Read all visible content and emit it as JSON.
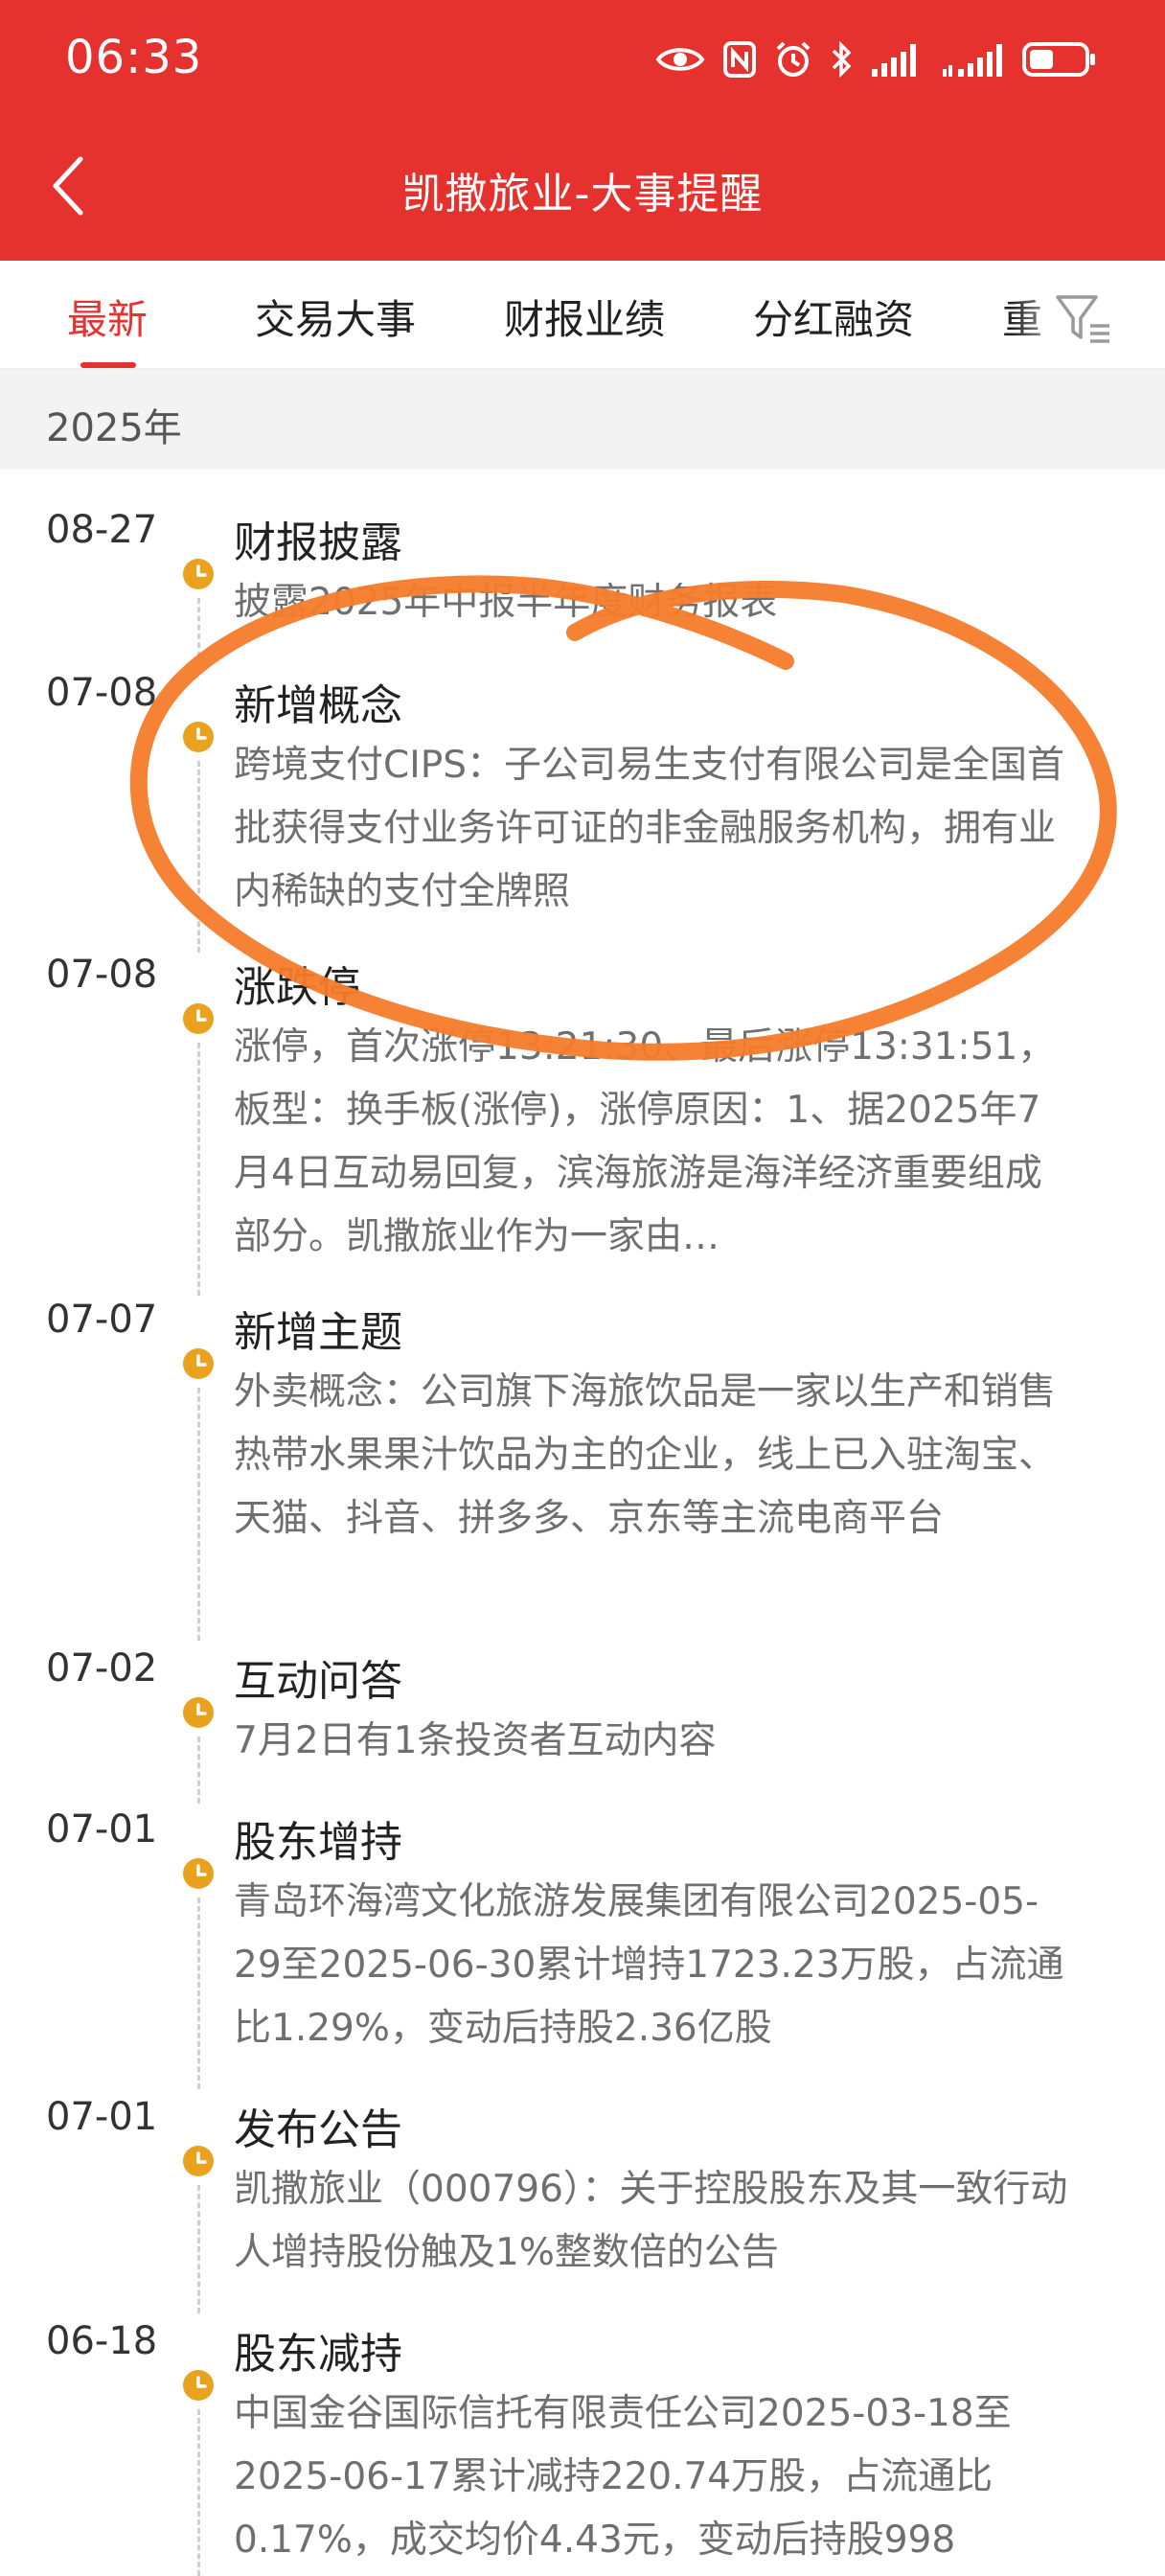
{
  "status_bar": {
    "time": "06:33",
    "battery_level": 0.45
  },
  "header": {
    "title": "凯撒旅业-大事提醒",
    "back_icon": "chevron-left-icon",
    "background_color": "#e5322f"
  },
  "tabs": [
    {
      "label": "最新",
      "active": true
    },
    {
      "label": "交易大事",
      "active": false
    },
    {
      "label": "财报业绩",
      "active": false
    },
    {
      "label": "分红融资",
      "active": false
    },
    {
      "label": "重",
      "active": false
    }
  ],
  "filter_icon": "filter-icon",
  "accent_color": "#e5322f",
  "timeline_dot_color": "#e8a21e",
  "highlight_stroke_color": "#f47b2a",
  "year": "2025年",
  "events": [
    {
      "date": "08-27",
      "title": "财报披露",
      "desc": "披露2025年中报半年度财务报表"
    },
    {
      "date": "07-08",
      "title": "新增概念",
      "desc": "跨境支付CIPS：子公司易生支付有限公司是全国首批获得支付业务许可证的非金融服务机构，拥有业内稀缺的支付全牌照"
    },
    {
      "date": "07-08",
      "title": "涨跌停",
      "desc": "涨停，首次涨停13:21:30、最后涨停13:31:51，板型：换手板(涨停)，涨停原因：1、据2025年7月4日互动易回复，滨海旅游是海洋经济重要组成部分。凯撒旅业作为一家由…"
    },
    {
      "date": "07-07",
      "title": "新增主题",
      "desc": "外卖概念：公司旗下海旅饮品是一家以生产和销售热带水果果汁饮品为主的企业，线上已入驻淘宝、天猫、抖音、拼多多、京东等主流电商平台"
    },
    {
      "date": "07-02",
      "title": "互动问答",
      "desc": "7月2日有1条投资者互动内容"
    },
    {
      "date": "07-01",
      "title": "股东增持",
      "desc": "青岛环海湾文化旅游发展集团有限公司2025-05-29至2025-06-30累计增持1723.23万股，占流通比1.29%，变动后持股2.36亿股"
    },
    {
      "date": "07-01",
      "title": "发布公告",
      "desc": "凯撒旅业（000796）：关于控股股东及其一致行动人增持股份触及1%整数倍的公告"
    },
    {
      "date": "06-18",
      "title": "股东减持",
      "desc": "中国金谷国际信托有限责任公司2025-03-18至2025-06-17累计减持220.74万股，占流通比0.17%，成交均价4.43元，变动后持股998"
    }
  ]
}
